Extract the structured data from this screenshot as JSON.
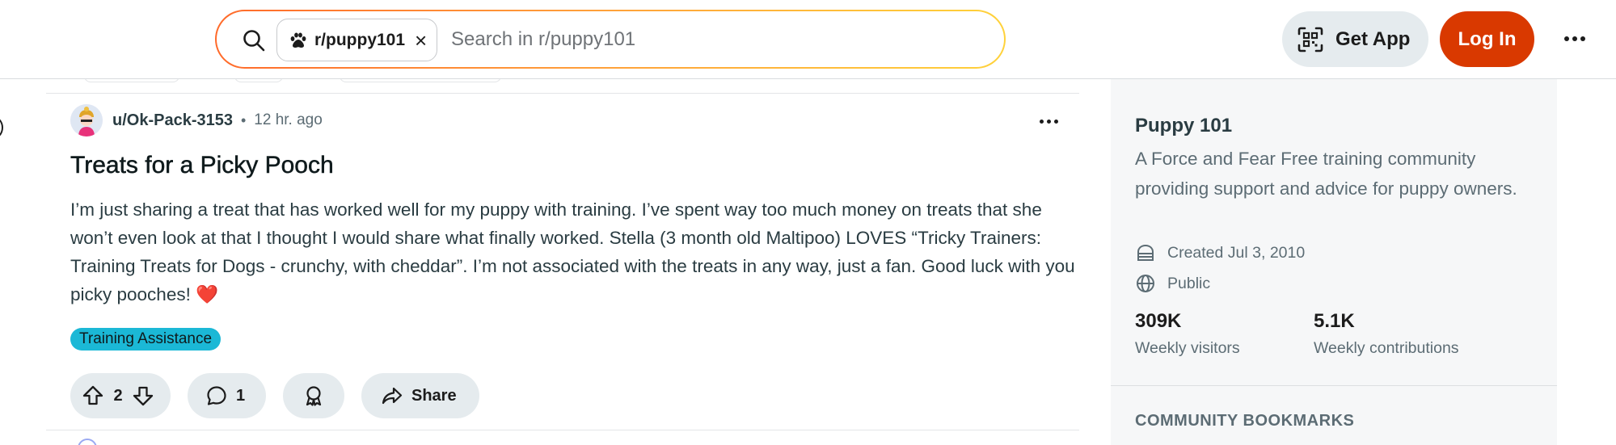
{
  "header": {
    "search": {
      "chip_label": "r/puppy101",
      "placeholder": "Search in r/puppy101",
      "value": ""
    },
    "get_app_label": "Get App",
    "login_label": "Log In",
    "colors": {
      "login_bg": "#d93900",
      "pill_bg": "#e5ebee"
    }
  },
  "post": {
    "author": "u/Ok-Pack-3153",
    "separator": "•",
    "time": "12 hr. ago",
    "title": "Treats for a Picky Pooch",
    "body": "I’m just sharing a treat that has worked well for my puppy with training. I’ve spent way too much money on treats that she won’t even look at that I thought I would share what finally worked. Stella (3 month old Maltipoo) LOVES “Tricky Trainers: Training Treats for Dogs - crunchy, with cheddar”. I’m not associated with the treats in any way, just a fan. Good luck with you picky pooches!",
    "body_emoji": "❤️",
    "flair": "Training Assistance",
    "flair_color": "#1bb8d6",
    "votes": "2",
    "comments": "1",
    "share_label": "Share"
  },
  "sidebar": {
    "name": "Puppy 101",
    "description": "A Force and Fear Free training community providing support and advice for puppy owners.",
    "created": "Created Jul 3, 2010",
    "visibility": "Public",
    "stats": [
      {
        "value": "309K",
        "label": "Weekly visitors"
      },
      {
        "value": "5.1K",
        "label": "Weekly contributions"
      }
    ],
    "bookmarks_heading": "COMMUNITY BOOKMARKS"
  }
}
